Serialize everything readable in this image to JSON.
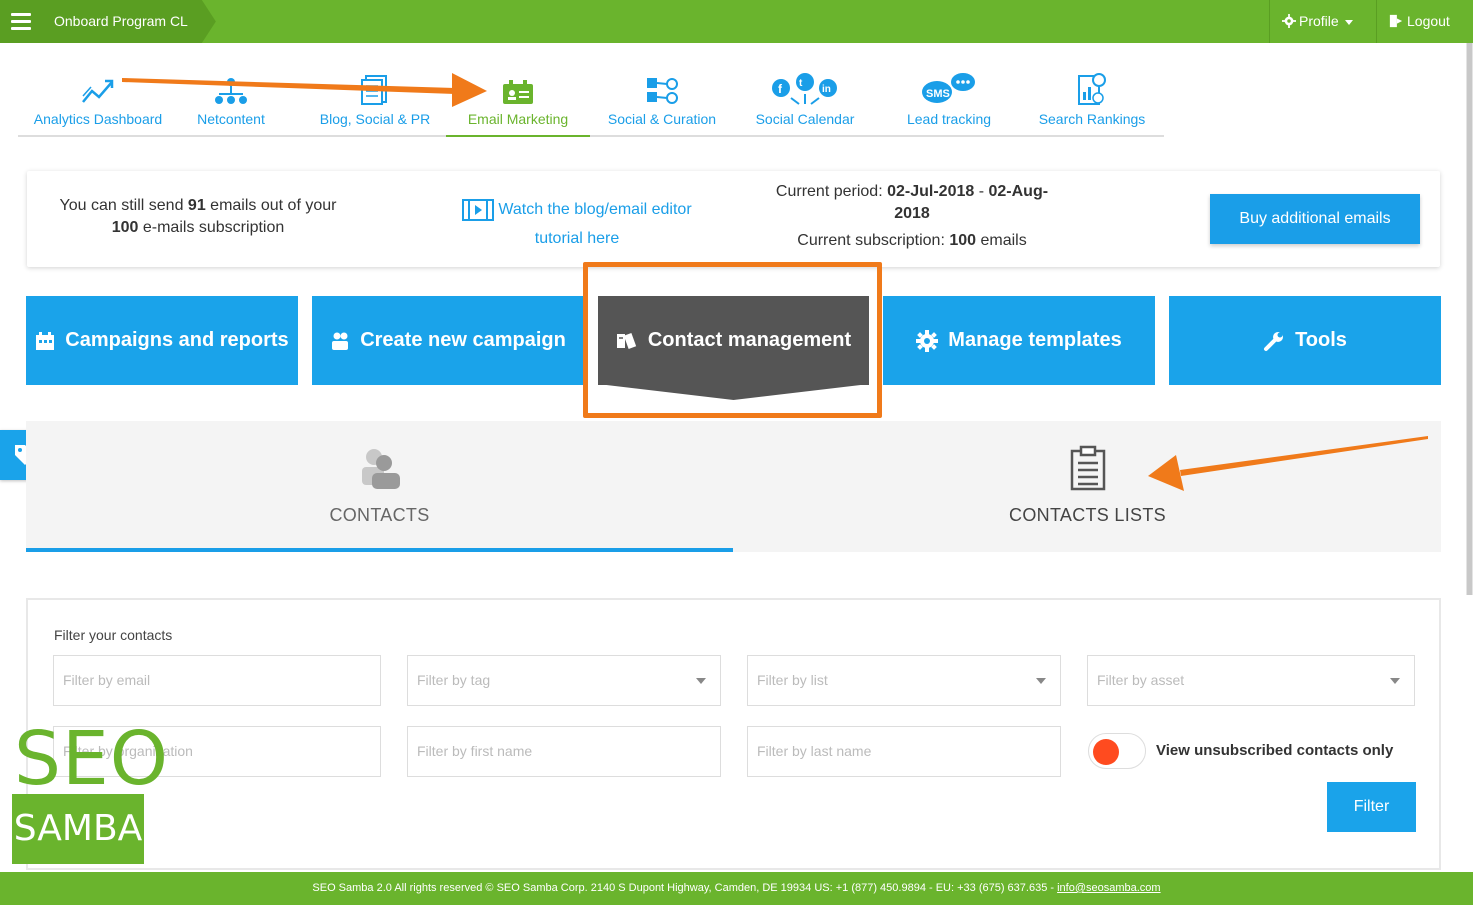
{
  "topbar": {
    "crumb": "Onboard Program CL",
    "profile_label": "Profile",
    "logout_label": "Logout"
  },
  "nav": {
    "tabs": [
      {
        "label": "Analytics Dashboard",
        "icon": "analytics-icon"
      },
      {
        "label": "Netcontent",
        "icon": "network-icon"
      },
      {
        "label": "Blog, Social & PR",
        "icon": "document-icon"
      },
      {
        "label": "Email Marketing",
        "icon": "email-card-icon",
        "active": true
      },
      {
        "label": "Social & Curation",
        "icon": "curation-icon"
      },
      {
        "label": "Social Calendar",
        "icon": "social-icons"
      },
      {
        "label": "Lead tracking",
        "icon": "sms-chat-icon"
      },
      {
        "label": "Search Rankings",
        "icon": "seo-rankings-icon"
      }
    ]
  },
  "info": {
    "send_pre": "You can still send",
    "send_count": "91",
    "send_mid": "emails out of your",
    "subscription_count": "100",
    "send_post": "e-mails subscription",
    "tutorial_line1": "Watch the blog/email editor",
    "tutorial_line2": "tutorial here",
    "period_label": "Current period:",
    "period_start": "02-Jul-2018",
    "period_sep": "-",
    "period_end_a": "02-Aug-",
    "period_end_b": "2018",
    "sub_label": "Current subscription:",
    "sub_value": "100",
    "sub_unit": "emails",
    "buy_label": "Buy additional emails"
  },
  "tiles": [
    {
      "label": "Campaigns and reports",
      "icon": "calendar-icon"
    },
    {
      "label": "Create new campaign",
      "icon": "users-icon"
    },
    {
      "label": "Contact management",
      "icon": "address-book-icon",
      "active": true
    },
    {
      "label": "Manage templates",
      "icon": "gear-icon"
    },
    {
      "label": "Tools",
      "icon": "wrench-icon"
    }
  ],
  "contact_tabs": [
    {
      "label": "CONTACTS",
      "icon": "contacts-icon",
      "active": true
    },
    {
      "label": "CONTACTS LISTS",
      "icon": "clipboard-icon"
    }
  ],
  "filters": {
    "title": "Filter your contacts",
    "email_placeholder": "Filter by email",
    "tag_placeholder": "Filter by tag",
    "list_placeholder": "Filter by list",
    "asset_placeholder": "Filter by asset",
    "org_placeholder": "Filter by organization",
    "first_placeholder": "Filter by first name",
    "last_placeholder": "Filter by last name",
    "unsub_label": "View unsubscribed contacts only",
    "filter_button": "Filter"
  },
  "logo": {
    "top": "SEO",
    "bottom": "SAMBA"
  },
  "footer": {
    "text": "SEO Samba 2.0  All rights reserved © SEO Samba Corp. 2140 S Dupont Highway, Camden, DE 19934 US: +1 (877) 450.9894 - EU: +33 (675) 637.635 - ",
    "email": "info@seosamba.com"
  },
  "colors": {
    "brand_green": "#6ab42d",
    "accent_blue": "#1aa3ea",
    "active_tile": "#555555",
    "annotation_orange": "#f07a1a",
    "toggle_off": "#ff4b1f"
  }
}
